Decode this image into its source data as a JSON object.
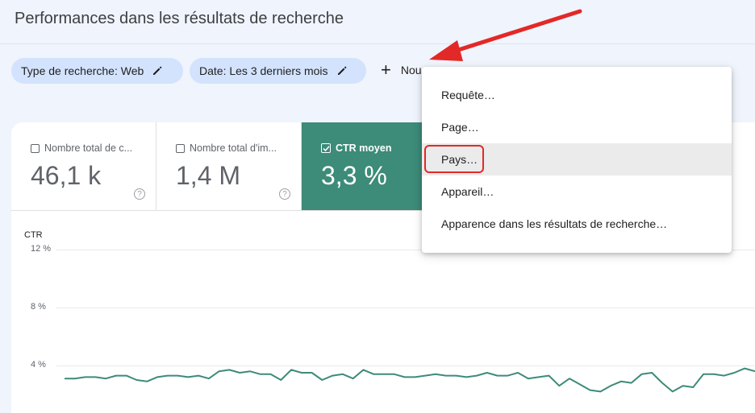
{
  "header": {
    "title": "Performances dans les résultats de recherche"
  },
  "filters": {
    "chips": [
      {
        "label": "Type de recherche: Web",
        "icon": "pencil-icon"
      },
      {
        "label": "Date: Les 3 derniers mois",
        "icon": "pencil-icon"
      }
    ],
    "add_label": "Nou",
    "add_icon": "plus-icon"
  },
  "metrics": [
    {
      "label": "Nombre total de c...",
      "value": "46,1 k",
      "checked": false,
      "help": "?"
    },
    {
      "label": "Nombre total d'im...",
      "value": "1,4 M",
      "checked": false,
      "help": "?"
    },
    {
      "label": "CTR moyen",
      "value": "3,3 %",
      "checked": true,
      "color": "#3d8b79"
    }
  ],
  "chart": {
    "ylabel": "CTR",
    "ticks": [
      "12 %",
      "8 %",
      "4 %"
    ]
  },
  "chart_data": {
    "type": "line",
    "ylabel": "CTR",
    "ylim": [
      0,
      12
    ],
    "yticks": [
      "4 %",
      "8 %",
      "12 %"
    ],
    "grid": true,
    "series": [
      {
        "color": "#3d8b79",
        "values": [
          3.1,
          3.1,
          3.2,
          3.2,
          3.1,
          3.3,
          3.3,
          3.0,
          2.9,
          3.2,
          3.3,
          3.3,
          3.2,
          3.3,
          3.1,
          3.6,
          3.7,
          3.5,
          3.6,
          3.4,
          3.4,
          3.0,
          3.7,
          3.5,
          3.5,
          3.0,
          3.3,
          3.4,
          3.1,
          3.7,
          3.4,
          3.4,
          3.4,
          3.2,
          3.2,
          3.3,
          3.4,
          3.3,
          3.3,
          3.2,
          3.3,
          3.5,
          3.3,
          3.3,
          3.5,
          3.1,
          3.2,
          3.3,
          2.6,
          3.1,
          2.7,
          2.3,
          2.2,
          2.6,
          2.9,
          2.8,
          3.4,
          3.5,
          2.8,
          2.2,
          2.6,
          2.5,
          3.4,
          3.4,
          3.3,
          3.5,
          3.8,
          3.6
        ]
      }
    ]
  },
  "menu": {
    "items": [
      "Requête…",
      "Page…",
      "Pays…",
      "Appareil…",
      "Apparence dans les résultats de recherche…"
    ],
    "highlighted_index": 2
  },
  "annotation": {
    "color": "#e32828"
  }
}
